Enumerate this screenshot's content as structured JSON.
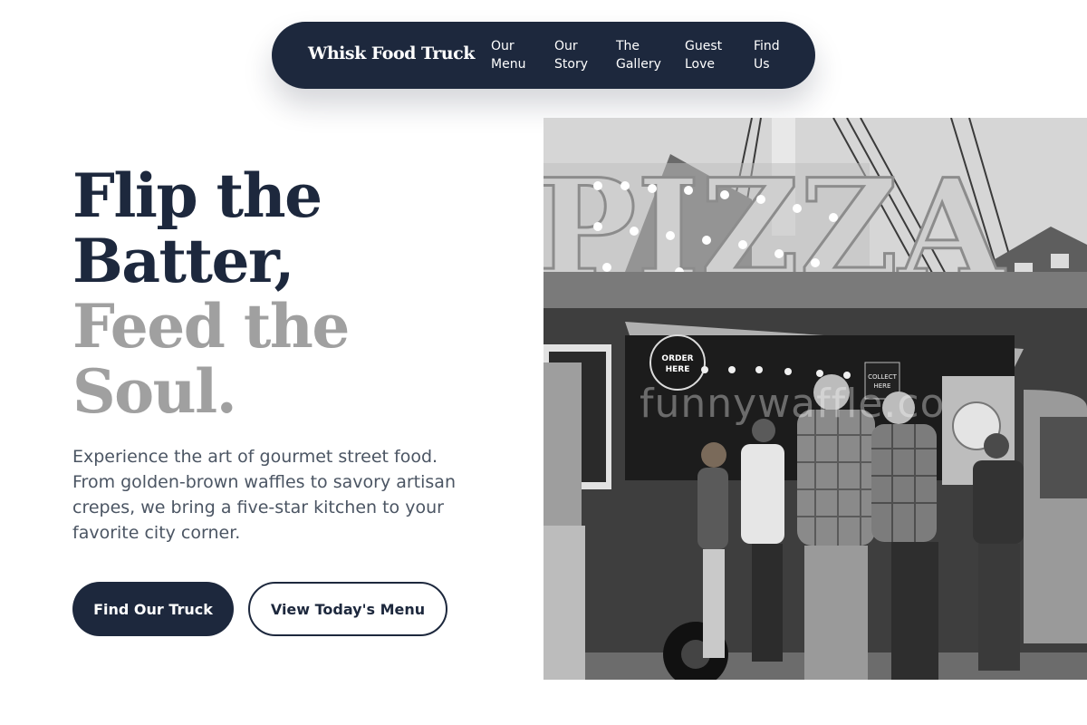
{
  "nav": {
    "brand": "Whisk Food Truck",
    "links": [
      {
        "line1": "Our",
        "line2": "Menu"
      },
      {
        "line1": "Our",
        "line2": "Story"
      },
      {
        "line1": "The",
        "line2": "Gallery"
      },
      {
        "line1": "Guest",
        "line2": "Love"
      },
      {
        "line1": "Find",
        "line2": "Us"
      }
    ]
  },
  "hero": {
    "title_line1": "Flip the",
    "title_line2": "Batter,",
    "title_line3": "Feed the",
    "title_line4": "Soul.",
    "description": "Experience the art of gourmet street food. From golden-brown waffles to savory artisan crepes, we bring a five-star kitchen to your favorite city corner.",
    "primary_button": "Find Our Truck",
    "secondary_button": "View Today's Menu"
  },
  "image": {
    "sign_text": "PIZZA",
    "order_badge": "ORDER HERE",
    "collect_badge": "COLLECT HERE",
    "watermark": "funnywaffle.co"
  },
  "colors": {
    "navy": "#1d283d",
    "muted_gray": "#a0a0a0",
    "body_text": "#4b5563"
  }
}
